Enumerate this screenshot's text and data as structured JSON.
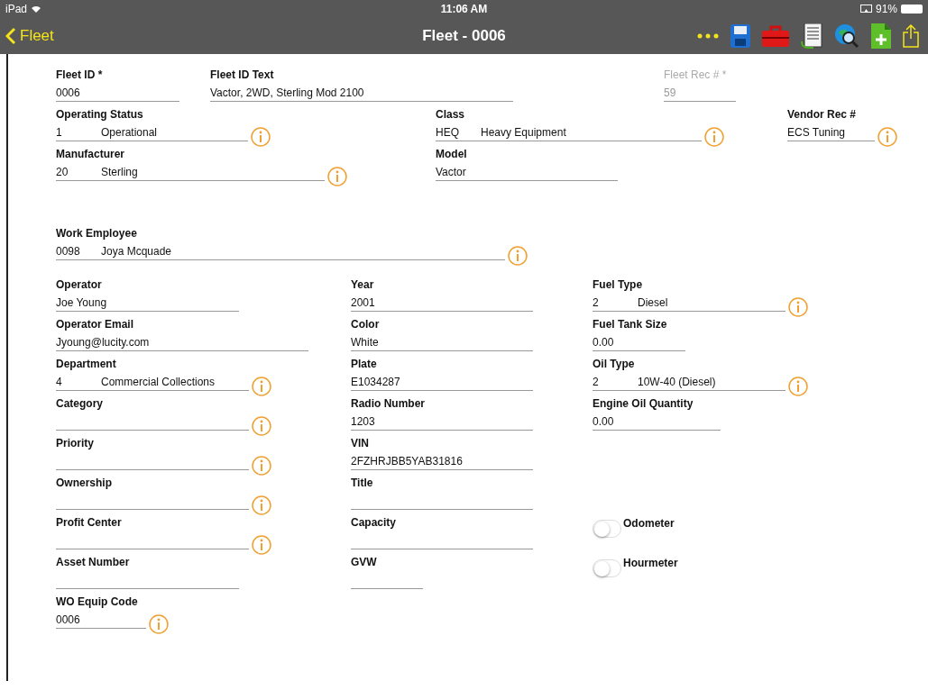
{
  "status_bar": {
    "device": "iPad",
    "time": "11:06 AM",
    "battery": "91%"
  },
  "nav_bar": {
    "back": "Fleet",
    "title": "Fleet - 0006"
  },
  "form": {
    "rows": [
      [
        {
          "kind": "text",
          "label": "Fleet ID *",
          "value": "0006"
        },
        {
          "kind": "text",
          "label": "Fleet ID Text",
          "value": "Vactor, 2WD, Sterling Mod 2100"
        },
        {
          "kind": "text",
          "label": "Fleet Rec # *",
          "value": "59",
          "disabled": true
        }
      ],
      [
        {
          "kind": "lookup",
          "label": "Operating Status",
          "code": "1",
          "description": "Operational",
          "info": true
        },
        {
          "kind": "lookup",
          "label": "Class",
          "code": "HEQ",
          "description": "Heavy Equipment",
          "info": true
        },
        {
          "kind": "text",
          "label": "Vendor Rec #",
          "value": "ECS Tuning",
          "info": true
        }
      ],
      [
        {
          "kind": "lookup",
          "label": "Manufacturer",
          "code": "20",
          "description": "Sterling",
          "info": true
        },
        {
          "kind": "text",
          "label": "Model",
          "value": "Vactor"
        }
      ],
      [
        {
          "kind": "lookup",
          "label": "Work Employee",
          "code": "0098",
          "description": "Joya Mcquade",
          "info": true
        }
      ]
    ],
    "left_column": [
      {
        "kind": "text",
        "label": "Operator",
        "value": "Joe Young"
      },
      {
        "kind": "text",
        "label": "Operator Email",
        "value": "Jyoung@lucity.com"
      },
      {
        "kind": "lookup",
        "label": "Department",
        "code": "4",
        "description": "Commercial Collections",
        "info": true
      },
      {
        "kind": "text",
        "label": "Category",
        "info": true
      },
      {
        "kind": "text",
        "label": "Priority",
        "info": true
      },
      {
        "kind": "text",
        "label": "Ownership",
        "info": true
      },
      {
        "kind": "text",
        "label": "Profit Center",
        "info": true
      },
      {
        "kind": "text",
        "label": "Asset Number"
      },
      {
        "kind": "text",
        "label": "WO Equip Code",
        "value": "0006",
        "info": true
      }
    ],
    "middle_column": [
      {
        "kind": "text",
        "label": "Year",
        "value": "2001"
      },
      {
        "kind": "text",
        "label": "Color",
        "value": "White"
      },
      {
        "kind": "text",
        "label": "Plate",
        "value": " E1034287"
      },
      {
        "kind": "text",
        "label": "Radio Number",
        "value": "1203"
      },
      {
        "kind": "text",
        "label": "VIN",
        "value": "2FZHRJBB5YAB31816"
      },
      {
        "kind": "text",
        "label": "Title"
      },
      {
        "kind": "text",
        "label": "Capacity"
      },
      {
        "kind": "text",
        "label": "GVW"
      }
    ],
    "right_column": [
      {
        "kind": "lookup",
        "label": "Fuel Type",
        "code": "2",
        "description": "Diesel",
        "info": true
      },
      {
        "kind": "text",
        "label": "Fuel Tank Size",
        "value": "0.00"
      },
      {
        "kind": "lookup",
        "label": "Oil Type",
        "code": "2",
        "description": "10W-40 (Diesel)",
        "info": true
      },
      {
        "kind": "text",
        "label": "Engine Oil Quantity",
        "value": "0.00"
      },
      {
        "kind": "toggle",
        "label": "Odometer",
        "on": false
      },
      {
        "kind": "toggle",
        "label": "Hourmeter",
        "on": false
      }
    ]
  }
}
